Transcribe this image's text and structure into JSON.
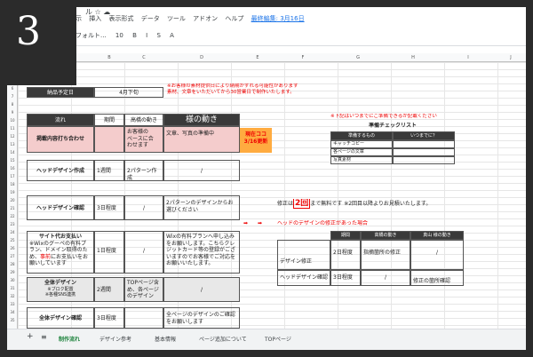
{
  "badge_number": "3",
  "header": {
    "title_suffix": "ル",
    "menu": [
      "表示",
      "挿入",
      "表示形式",
      "データ",
      "ツール",
      "アドオン",
      "ヘルプ"
    ],
    "last_edit": "最終編集: 3月16日"
  },
  "toolbar": {
    "font": "デフォルト...",
    "size": "10",
    "items": [
      "B",
      "I",
      "S",
      "A"
    ]
  },
  "columns": [
    "A",
    "B",
    "C",
    "D",
    "E",
    "F",
    "G",
    "H",
    "I",
    "J"
  ],
  "rows": [
    "3",
    "4",
    "5",
    "6",
    "7",
    "8",
    "9",
    "10",
    "11",
    "12",
    "13",
    "14",
    "15",
    "16",
    "17",
    "18",
    "19",
    "20",
    "21",
    "22",
    "23",
    "24",
    "25",
    "26",
    "27",
    "28",
    "29",
    "30",
    "31",
    "32",
    "33",
    "34",
    "35"
  ],
  "delivery": {
    "label": "納品予定日",
    "value": "4月下旬",
    "note": "※お客様の素材提供日により納期がずれる可能性があります\n素材、文章をいただいてから30営業日で制作いたします。"
  },
  "table_headers": {
    "flow": "流れ",
    "period": "期間",
    "movement": "高橋の動き",
    "client": "様の動き"
  },
  "now_here": {
    "line1": "現在ココ",
    "line2": "3/16更新"
  },
  "rows_data": [
    {
      "flow": "掲載内容打ち合わせ",
      "period": "",
      "movement": "お客様の\nベースに合\nわせます",
      "client_move": "/",
      "client": "文章、写真の準備中"
    },
    {
      "flow": "ヘッドデザイン作成",
      "period": "1週間",
      "movement": "2パターン作成",
      "client": "/"
    },
    {
      "flow": "ヘッドデザイン確認",
      "period": "3日程度",
      "movement": "/",
      "client": "2パターンのデザインからお選びください"
    },
    {
      "flow": "サイト代お支払い",
      "note": "※Wixのグーペの有料プラン、ドメイン取得のため、",
      "note_red": "事前",
      "note_tail": "にお支払いをお願いしています",
      "period": "1日程度",
      "movement": "/",
      "client": "Wixの有料プランへ申し込みをお願いします。こちらクレジットカード等の登録がございますのでお客様でご対応をお願いいたします。"
    },
    {
      "flow": "全体デザイン",
      "sub": "※ブロク配置\n※各種SNS連携",
      "period": "2週間",
      "movement": "TOPページ含め、各ページのデザイン",
      "client": "/"
    },
    {
      "flow": "全体デザイン確認",
      "period": "3日程度",
      "movement": "",
      "client": "全ページのデザインのご確認をお願いします"
    }
  ],
  "checklist": {
    "note": "※下記はいつまでにご準備できるか記載ください",
    "title": "準備チェックリスト",
    "headers": [
      "準備するもの",
      "いつまでに？"
    ],
    "items": [
      "キャッチコピー",
      "各ページの文章",
      "写真素材"
    ]
  },
  "revision": {
    "prefix": "修正は",
    "count": "2回",
    "suffix": "まで無料です ※2回目以降よりお見積いたします。"
  },
  "head_revision": {
    "title": "ヘッドのデザインの修正があった場合",
    "headers": [
      "期間",
      "高橋の動き",
      "真山 様の動き"
    ],
    "rows": [
      {
        "label": "デザイン修正",
        "period": "2日程度",
        "movement": "指摘箇所の修正",
        "client": "/"
      },
      {
        "label": "ヘッドデザイン確認",
        "period": "3日程度",
        "movement": "/",
        "client": "修正の箇所確認"
      }
    ]
  },
  "tabs": [
    {
      "label": "制作流れ",
      "active": true
    },
    {
      "label": "デザイン参考",
      "active": false
    },
    {
      "label": "基本情報",
      "active": false
    },
    {
      "label": "ページ追加について",
      "active": false
    },
    {
      "label": "TOPページ",
      "active": false
    }
  ]
}
